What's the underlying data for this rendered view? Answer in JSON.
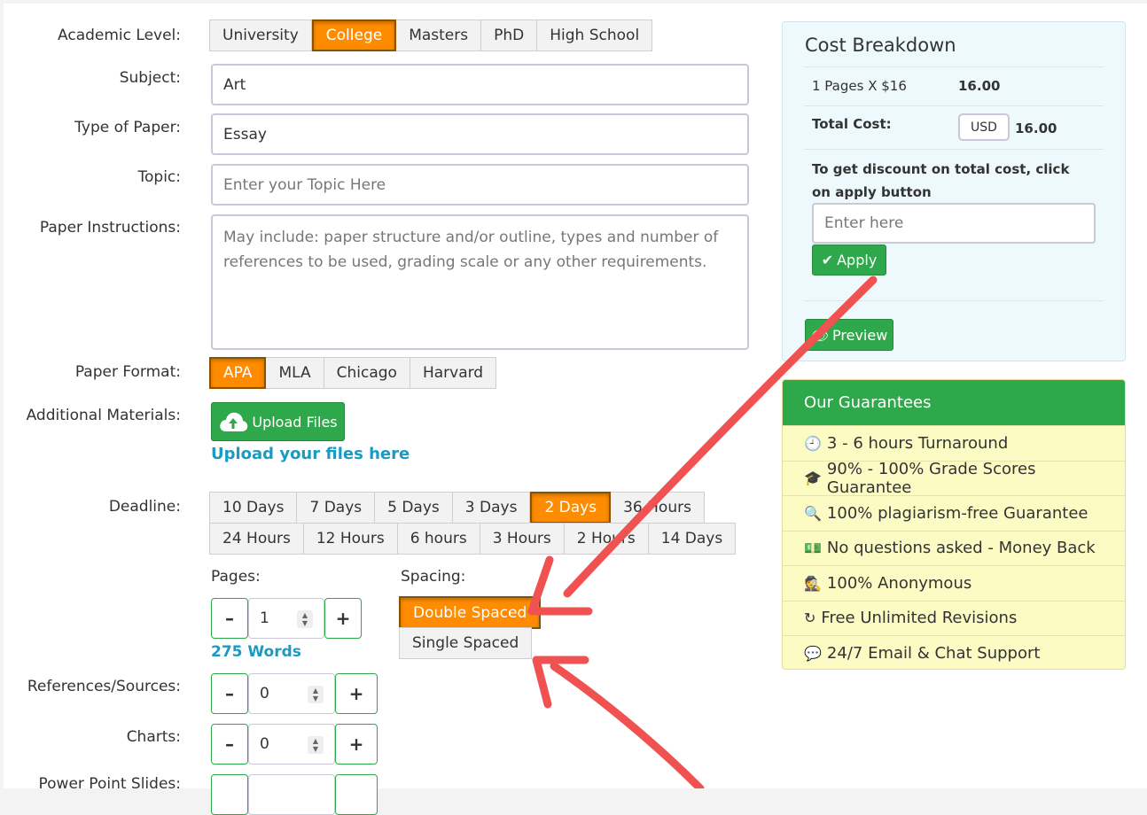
{
  "form": {
    "academic_level": {
      "label": "Academic Level:",
      "options": [
        "University",
        "College",
        "Masters",
        "PhD",
        "High School"
      ],
      "selected": "College"
    },
    "subject": {
      "label": "Subject:",
      "value": "Art"
    },
    "type_of_paper": {
      "label": "Type of Paper:",
      "value": "Essay"
    },
    "topic": {
      "label": "Topic:",
      "placeholder": "Enter your Topic Here"
    },
    "instructions": {
      "label": "Paper Instructions:",
      "placeholder": "May include: paper structure and/or outline, types and number of references to be used, grading scale or any other requirements."
    },
    "paper_format": {
      "label": "Paper Format:",
      "options": [
        "APA",
        "MLA",
        "Chicago",
        "Harvard"
      ],
      "selected": "APA"
    },
    "materials": {
      "label": "Additional Materials:",
      "button": "Upload Files",
      "link": "Upload your files here"
    },
    "deadline": {
      "label": "Deadline:",
      "row1": [
        "10 Days",
        "7 Days",
        "5 Days",
        "3 Days",
        "2 Days",
        "36 Hours"
      ],
      "row2": [
        "24 Hours",
        "12 Hours",
        "6 hours",
        "3 Hours",
        "2 Hours",
        "14 Days"
      ],
      "selected": "2 Days"
    },
    "pages": {
      "label": "Pages:",
      "value": "1",
      "words": "275 Words",
      "minus": "–",
      "plus": "+"
    },
    "spacing": {
      "label": "Spacing:",
      "options": [
        "Double Spaced",
        "Single Spaced"
      ],
      "selected": "Double Spaced"
    },
    "references": {
      "label": "References/Sources:",
      "value": "0"
    },
    "charts": {
      "label": "Charts:",
      "value": "0"
    },
    "slides": {
      "label": "Power Point Slides:"
    }
  },
  "cost": {
    "title": "Cost Breakdown",
    "line_label": "1 Pages X $16",
    "line_value": "16.00",
    "total_label": "Total Cost:",
    "currency": "USD",
    "total_value": "16.00",
    "discount_text": "To get discount on total cost, click on apply button",
    "discount_placeholder": "Enter here",
    "apply": "Apply",
    "preview": "Preview"
  },
  "guarantees": {
    "title": "Our Guarantees",
    "items": [
      {
        "icon": "clock-icon",
        "text": "3 - 6 hours Turnaround"
      },
      {
        "icon": "graduation-cap-icon",
        "text": "90% - 100% Grade Scores Guarantee"
      },
      {
        "icon": "search-icon",
        "text": "100% plagiarism-free Guarantee"
      },
      {
        "icon": "money-icon",
        "text": "No questions asked - Money Back"
      },
      {
        "icon": "user-secret-icon",
        "text": "100% Anonymous"
      },
      {
        "icon": "refresh-icon",
        "text": "Free Unlimited Revisions"
      },
      {
        "icon": "comments-icon",
        "text": "24/7 Email & Chat Support"
      }
    ]
  },
  "colors": {
    "accent": "#ff8c00",
    "green": "#2ea84a",
    "link": "#1a9bc2",
    "arrow": "#f05252"
  }
}
